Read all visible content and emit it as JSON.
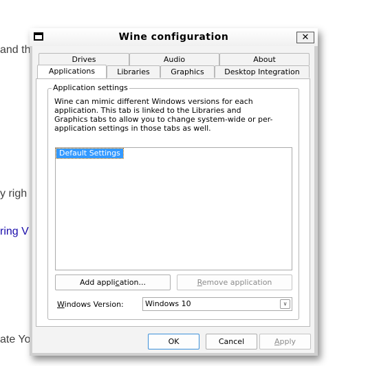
{
  "background_page": {
    "fragments": [
      {
        "text": "and th",
        "link": false
      },
      {
        "text": "y righ",
        "link": false
      },
      {
        "text": "ring V",
        "link": true
      },
      {
        "text": "ate Yo",
        "link": false
      }
    ]
  },
  "window": {
    "title": "Wine configuration",
    "close_label": "✕"
  },
  "tabs": {
    "row_back": [
      {
        "label": "Drives"
      },
      {
        "label": "Audio"
      },
      {
        "label": "About"
      }
    ],
    "row_front": [
      {
        "label": "Applications",
        "active": true
      },
      {
        "label": "Libraries"
      },
      {
        "label": "Graphics"
      },
      {
        "label": "Desktop Integration"
      }
    ]
  },
  "applications": {
    "group_label": "Application settings",
    "description": "Wine can mimic different Windows versions for each application. This tab is linked to the Libraries and Graphics tabs to allow you to change system-wide or per-application settings in those tabs as well.",
    "list_items": [
      {
        "label": "Default Settings",
        "selected": true
      }
    ],
    "add_button": {
      "pre": "Add appli",
      "mnemonic": "c",
      "post": "ation..."
    },
    "remove_button": {
      "pre": "",
      "mnemonic": "R",
      "post": "emove application",
      "disabled": true
    },
    "windows_version_label": {
      "pre": "",
      "mnemonic": "W",
      "post": "indows Version:"
    },
    "windows_version_value": "Windows 10"
  },
  "footer": {
    "ok_label": "OK",
    "cancel_label": "Cancel",
    "apply": {
      "pre": "",
      "mnemonic": "A",
      "post": "pply",
      "disabled": true
    }
  }
}
